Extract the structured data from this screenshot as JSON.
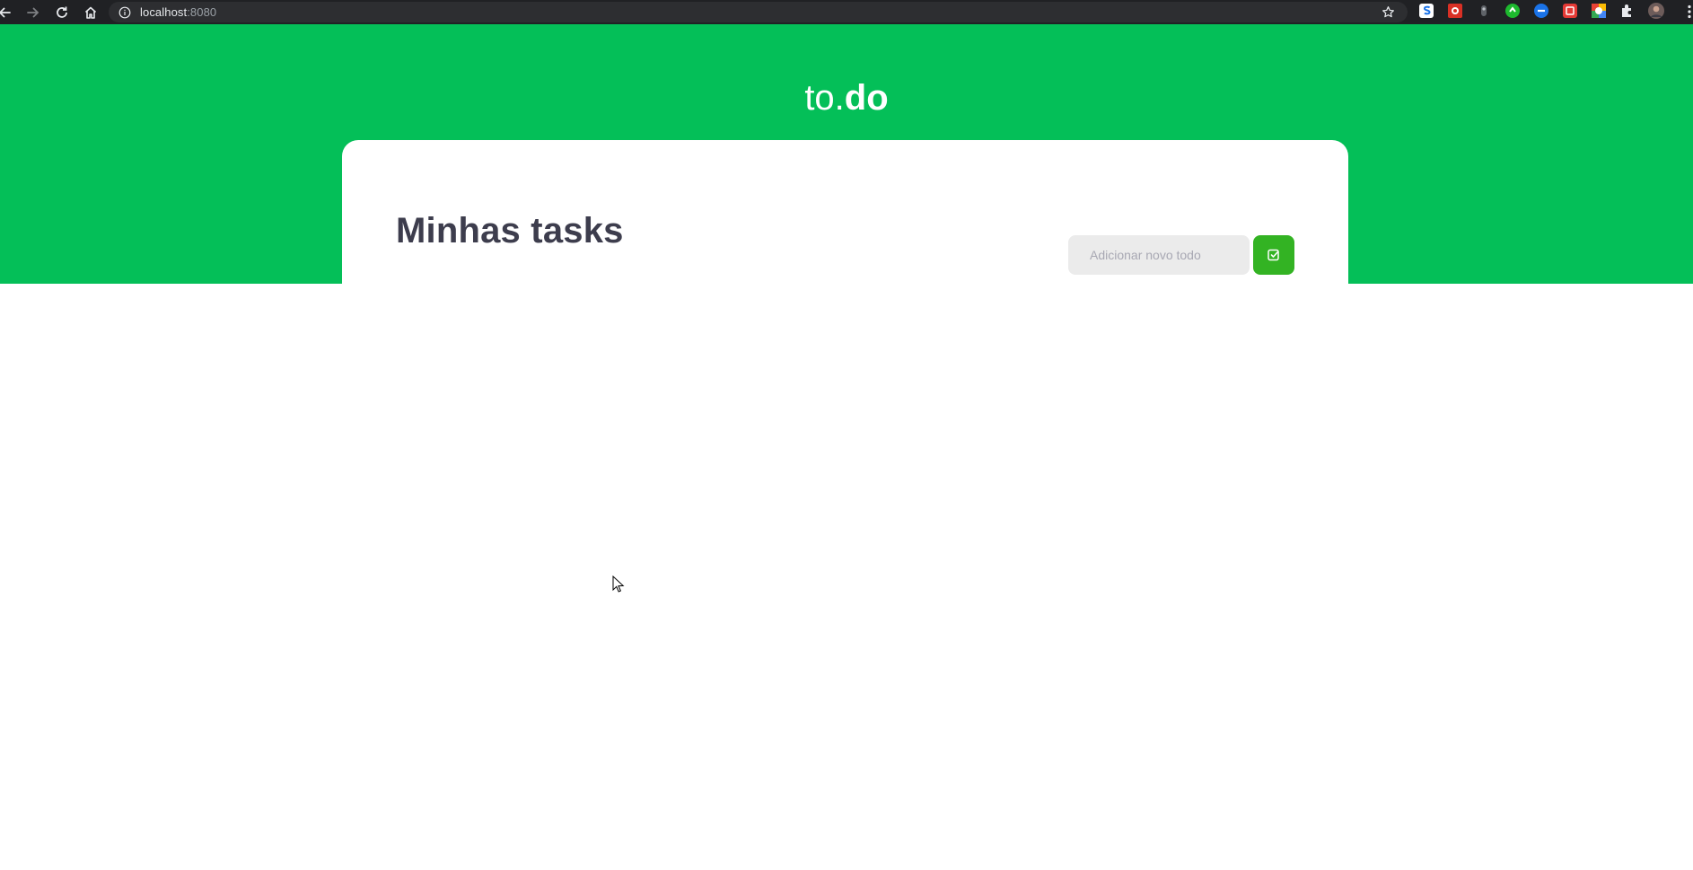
{
  "browser": {
    "url_host": "localhost",
    "url_port": ":8080",
    "icons": [
      "back-icon",
      "forward-icon",
      "reload-icon",
      "home-icon",
      "info-icon",
      "star-icon",
      "extensions-icon",
      "menu-icon"
    ],
    "extension_colors": [
      "#1a73e8",
      "#d93025",
      "#9aa0a6",
      "#1db92e",
      "#1a73e8",
      "#e53935",
      "#ff9800"
    ]
  },
  "header": {
    "logo_light": "to.",
    "logo_bold": "do"
  },
  "tasks": {
    "title": "Minhas tasks",
    "input_placeholder": "Adicionar novo todo",
    "input_value": ""
  },
  "colors": {
    "brand_green": "#04bf58",
    "button_green": "#33b323",
    "title_text": "#3d3d4d",
    "input_bg": "#ebebeb",
    "placeholder": "#a8a8b3"
  }
}
